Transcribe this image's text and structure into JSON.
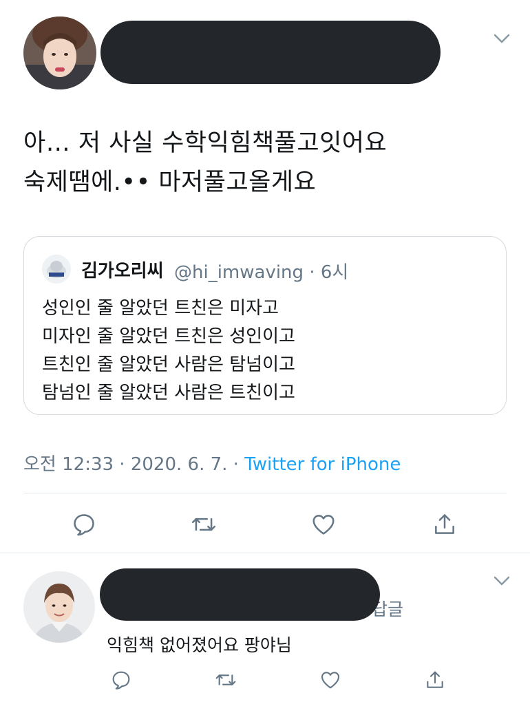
{
  "tweet": {
    "text_lines": [
      "아… 저 사실 수학익힘책풀고잇어요",
      "숙제땜에.•• 마저풀고올게요"
    ],
    "quoted": {
      "name": "김가오리씨",
      "handle_time": "@hi_imwaving · 6시",
      "lines": [
        "성인인 줄 알았던 트친은 미자고",
        "미자인 줄 알았던 트친은 성인이고",
        "트친인 줄 알았던 사람은 탐넘이고",
        "탐넘인 줄 알았던 사람은 트친이고"
      ]
    },
    "timestamp": "오전 12:33 · 2020. 6. 7. · ",
    "source": "Twitter for iPhone"
  },
  "reply": {
    "partial_label": "답글",
    "text": "익힘책 없어졌어요 팡야님"
  },
  "icons": {
    "more": "chevron-down-icon",
    "reply": "reply-icon",
    "retweet": "retweet-icon",
    "like": "heart-icon",
    "share": "share-icon"
  },
  "colors": {
    "text": "#14171a",
    "secondary": "#657786",
    "link": "#1da1f2",
    "redaction": "#23272c",
    "border": "#d4dade"
  }
}
